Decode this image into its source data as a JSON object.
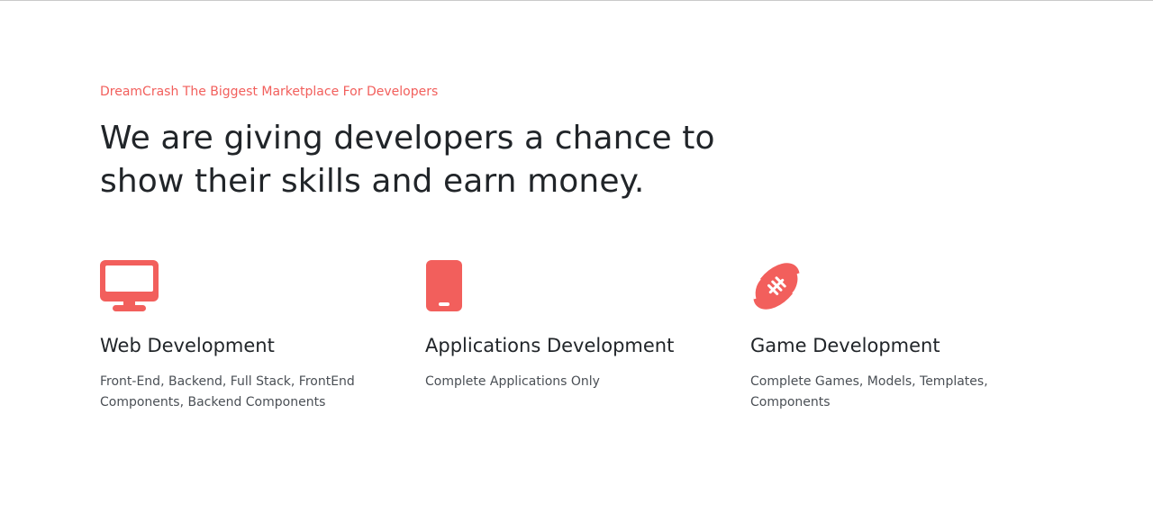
{
  "hero": {
    "eyebrow": "DreamCrash The Biggest Marketplace For Developers",
    "headline": "We are giving developers a chance to show their skills and earn money."
  },
  "features": [
    {
      "icon": "desktop-monitor-icon",
      "title": "Web Development",
      "description": "Front-End, Backend, Full Stack, FrontEnd Components, Backend Components"
    },
    {
      "icon": "mobile-phone-icon",
      "title": "Applications Development",
      "description": "Complete Applications Only"
    },
    {
      "icon": "football-icon",
      "title": "Game Development",
      "description": "Complete Games, Models, Templates, Components"
    }
  ],
  "colors": {
    "accent": "#f25f5c",
    "text": "#212529",
    "muted_text": "#4a4f55",
    "background": "#ffffff"
  }
}
